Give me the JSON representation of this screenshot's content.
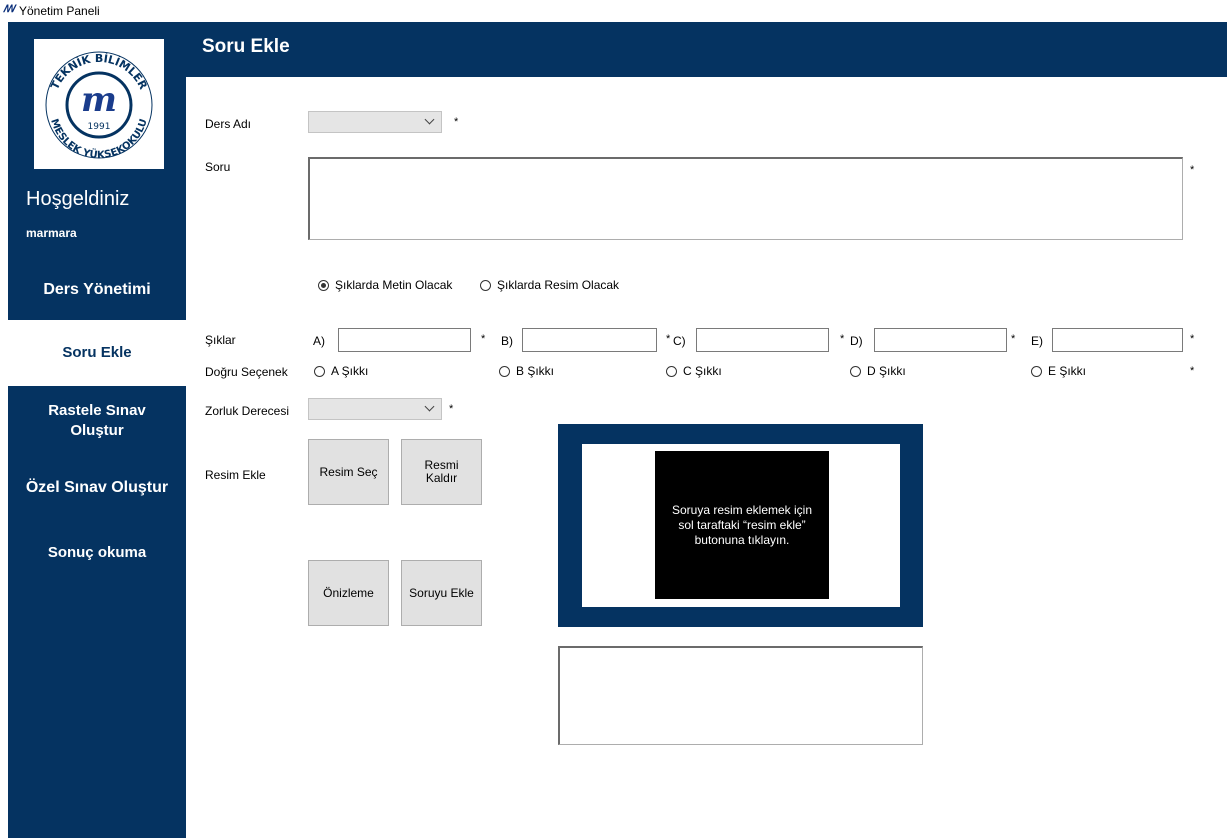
{
  "window": {
    "title": "Yönetim Paneli",
    "icon": "logo-m-icon"
  },
  "sidebar": {
    "welcome": "Hoşgeldiniz",
    "username": "marmara",
    "logo": {
      "top_text": "TEKNİK BİLİMLER",
      "bottom_text": "MESLEK YÜKSEKOKULU",
      "year": "1991"
    },
    "items": [
      {
        "label": "Ders Yönetimi",
        "active": false
      },
      {
        "label": "Soru Ekle",
        "active": true
      },
      {
        "label": "Rastele Sınav Oluştur",
        "active": false
      },
      {
        "label": "Özel Sınav Oluştur",
        "active": false
      },
      {
        "label": "Sonuç okuma",
        "active": false
      }
    ]
  },
  "header": {
    "title": "Soru Ekle"
  },
  "form": {
    "course_label": "Ders Adı",
    "course_value": "",
    "question_label": "Soru",
    "question_value": "",
    "required_mark": "*",
    "option_mode": {
      "text_label": "Şıklarda Metin Olacak",
      "image_label": "Şıklarda Resim Olacak",
      "selected": "text"
    },
    "options_label": "Şıklar",
    "options": [
      {
        "key": "A)",
        "value": ""
      },
      {
        "key": "B)",
        "value": ""
      },
      {
        "key": "C)",
        "value": ""
      },
      {
        "key": "D)",
        "value": ""
      },
      {
        "key": "E)",
        "value": ""
      }
    ],
    "correct_label": "Doğru Seçenek",
    "correct_options": [
      "A Şıkkı",
      "B Şıkkı",
      "C Şıkkı",
      "D Şıkkı",
      "E Şıkkı"
    ],
    "difficulty_label": "Zorluk Derecesi",
    "difficulty_value": "",
    "image_label": "Resim Ekle",
    "buttons": {
      "select_image": "Resim Seç",
      "remove_image_line1": "Resmi",
      "remove_image_line2": "Kaldır",
      "preview": "Önizleme",
      "add_question": "Soruyu Ekle"
    },
    "image_placeholder": "Soruya resim eklemek için sol taraftaki “resim ekle” butonuna tıklayın."
  },
  "colors": {
    "primary": "#053361",
    "button": "#e1e1e1",
    "combo": "#e5e5e5"
  }
}
